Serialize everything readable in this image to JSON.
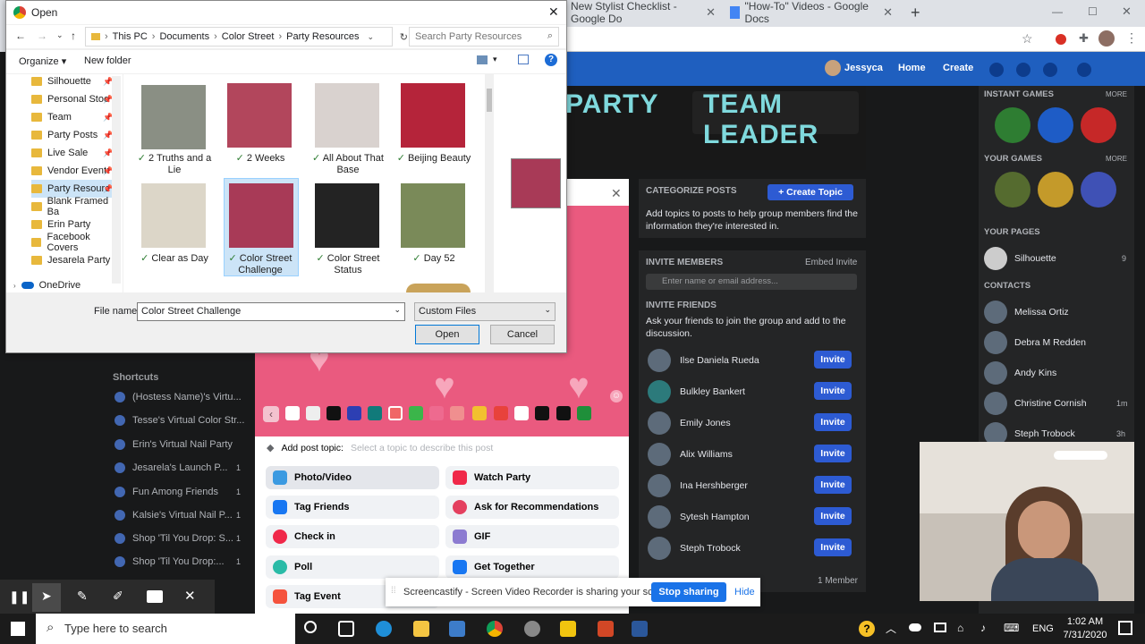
{
  "chrome": {
    "tab_checklist": "New Stylist Checklist - Google Do",
    "tab_videos": "\"How-To\" Videos - Google Docs",
    "new_tab": "+"
  },
  "facebook": {
    "nav_user": "Jessyca",
    "nav_home": "Home",
    "nav_create": "Create",
    "banner_left": "PARTY",
    "banner_right": "TEAM LEADER",
    "instant_games": "INSTANT GAMES",
    "your_games": "YOUR GAMES",
    "more": "MORE",
    "your_pages": "YOUR PAGES",
    "page_name": "Silhouette",
    "page_count": "9",
    "contacts_heading": "CONTACTS",
    "contacts": [
      {
        "name": "Melissa Ortiz",
        "meta": ""
      },
      {
        "name": "Debra M Redden",
        "meta": ""
      },
      {
        "name": "Andy Kins",
        "meta": ""
      },
      {
        "name": "Christine Cornish",
        "meta": "1m"
      },
      {
        "name": "Steph Trobock",
        "meta": "3h"
      }
    ],
    "categorize": {
      "heading": "CATEGORIZE POSTS",
      "create_topic": "+ Create Topic",
      "text": "Add topics to posts to help group members find the information they're interested in."
    },
    "invite_members": {
      "heading": "INVITE MEMBERS",
      "embed": "Embed Invite",
      "placeholder": "Enter name or email address...",
      "friends_heading": "INVITE FRIENDS",
      "friends_text": "Ask your friends to join the group and add to the discussion.",
      "invite_label": "Invite",
      "friends": [
        "Ilse Daniela Rueda",
        "Bulkley Bankert",
        "Emily Jones",
        "Alix Williams",
        "Ina Hershberger",
        "Sytesh Hampton",
        "Steph Trobock"
      ],
      "members": "1 Member"
    },
    "shortcuts": {
      "heading": "Shortcuts",
      "items": [
        {
          "label": "(Hostess Name)'s Virtu...",
          "badge": ""
        },
        {
          "label": "Tesse's Virtual Color Str...",
          "badge": ""
        },
        {
          "label": "Erin's Virtual Nail Party",
          "badge": ""
        },
        {
          "label": "Jesarela's Launch P...",
          "badge": "1"
        },
        {
          "label": "Fun Among Friends",
          "badge": "1"
        },
        {
          "label": "Kalsie's Virtual Nail P...",
          "badge": "1"
        },
        {
          "label": "Shop 'Til You Drop: S...",
          "badge": "1"
        },
        {
          "label": "Shop 'Til You Drop:...",
          "badge": "1"
        }
      ]
    },
    "composer": {
      "add_topic": "Add post topic:",
      "topic_placeholder": "Select a topic to describe this post",
      "options_left": [
        "Photo/Video",
        "Tag Friends",
        "Check in",
        "Poll",
        "Tag Event"
      ],
      "options_right": [
        "Watch Party",
        "Ask for Recommendations",
        "GIF",
        "Get Together"
      ],
      "left_colors": [
        "#3b9ae1",
        "#1877f2",
        "#f02849",
        "#2abba7",
        "#f5533d"
      ],
      "right_colors": [
        "#f02849",
        "#e4405f",
        "#8c7bd1",
        "#1877f2"
      ],
      "swatches": [
        "#ffffff",
        "#eeeeee",
        "#111111",
        "#2d3fb3",
        "#117a7a",
        "#f06666",
        "#3bb54a",
        "#ee6a8f",
        "#f08f8f",
        "#f2c02f",
        "#e8423b",
        "#ffffff",
        "#111111",
        "#1f8f3a"
      ]
    }
  },
  "dialog": {
    "title": "Open",
    "breadcrumb": [
      "This PC",
      "Documents",
      "Color Street",
      "Party Resources"
    ],
    "search_placeholder": "Search Party Resources",
    "organize": "Organize",
    "new_folder": "New folder",
    "nav_items": [
      "Silhouette",
      "Personal Stoc",
      "Team",
      "Party Posts",
      "Live Sale",
      "Vendor Event:",
      "Party Resourc",
      "Blank Framed Ba",
      "Erin Party",
      "Facebook Covers",
      "Jesarela Party",
      "OneDrive"
    ],
    "files": [
      {
        "name": "2 Truths and a Lie",
        "color": "#8a8f84"
      },
      {
        "name": "2 Weeks",
        "color": "#b2465c"
      },
      {
        "name": "All About That Base",
        "color": "#d9d2cf"
      },
      {
        "name": "Beijing Beauty",
        "color": "#b5243a"
      },
      {
        "name": "Clear as Day",
        "color": "#dcd6c8"
      },
      {
        "name": "Color Street Challenge",
        "color": "#a83a57"
      },
      {
        "name": "Color Street Status",
        "color": "#232323"
      },
      {
        "name": "Day 52",
        "color": "#7a8a59"
      }
    ],
    "file_name_label": "File name:",
    "file_name_value": "Color Street Challenge",
    "file_type": "Custom Files",
    "open": "Open",
    "cancel": "Cancel"
  },
  "screencastify": {
    "message": "Screencastify - Screen Video Recorder is sharing your screen.",
    "stop": "Stop sharing",
    "hide": "Hide"
  },
  "taskbar": {
    "search": "Type here to search",
    "lang": "ENG",
    "time": "1:02 AM",
    "date": "7/31/2020"
  }
}
